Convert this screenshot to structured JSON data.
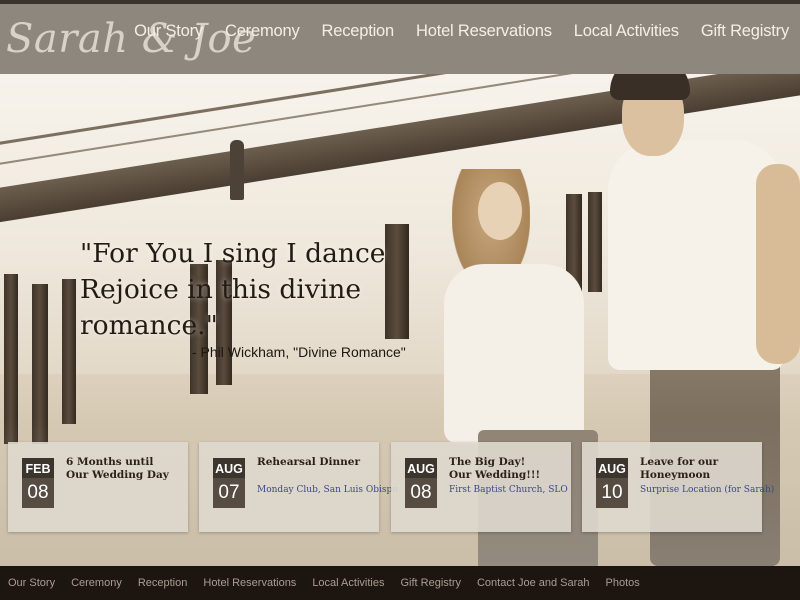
{
  "header": {
    "logo": "Sarah & Joe",
    "nav": [
      "Our Story",
      "Ceremony",
      "Reception",
      "Hotel Reservations",
      "Local Activities",
      "Gift Registry"
    ]
  },
  "hero": {
    "quote": "\"For You I sing I dance Rejoice in this divine romance.\"",
    "attribution": "- Phil Wickham, \"Divine Romance\""
  },
  "events": [
    {
      "month": "FEB",
      "day": "08",
      "title_line1": "6 Months until",
      "title_line2": "Our Wedding Day",
      "subtitle": ""
    },
    {
      "month": "AUG",
      "day": "07",
      "title_line1": "Rehearsal Dinner",
      "title_line2": "",
      "subtitle": "Monday Club, San Luis Obispo"
    },
    {
      "month": "AUG",
      "day": "08",
      "title_line1": "The Big Day!",
      "title_line2": "Our Wedding!!!",
      "subtitle": "First Baptist Church, SLO"
    },
    {
      "month": "AUG",
      "day": "10",
      "title_line1": "Leave for our",
      "title_line2": "Honeymoon",
      "subtitle": "Surprise Location (for Sarah)"
    }
  ],
  "footer": {
    "nav": [
      "Our Story",
      "Ceremony",
      "Reception",
      "Hotel Reservations",
      "Local Activities",
      "Gift Registry",
      "Contact Joe and Sarah",
      "Photos"
    ]
  },
  "colors": {
    "header_bg": "#8e877e",
    "footer_bg": "#1d1510",
    "calendar_bg": "#3c352e",
    "link_blue": "#3a4a82"
  }
}
